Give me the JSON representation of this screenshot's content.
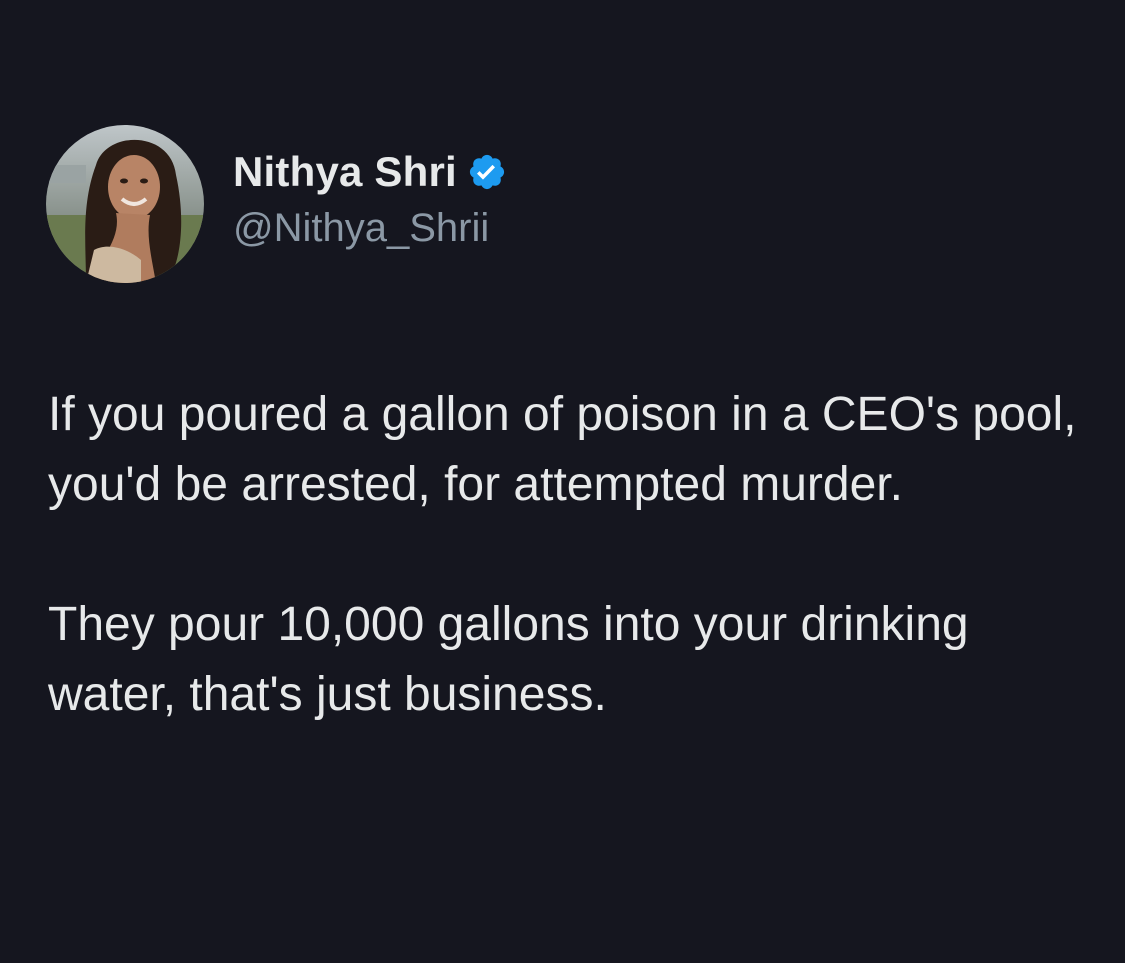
{
  "author": {
    "display_name": "Nithya Shri",
    "handle": "@Nithya_Shrii",
    "verified": true,
    "verified_icon": "verified-badge-icon",
    "verified_color": "#1d9bf0"
  },
  "tweet": {
    "paragraphs": [
      "If you poured a gallon of poison in a CEO's pool, you'd be arrested, for attempted murder.",
      "They pour 10,000 gallons into your drinking water, that's just business."
    ]
  },
  "colors": {
    "background": "#15161f",
    "text": "#e7e9ea",
    "handle": "#8b98a5"
  }
}
